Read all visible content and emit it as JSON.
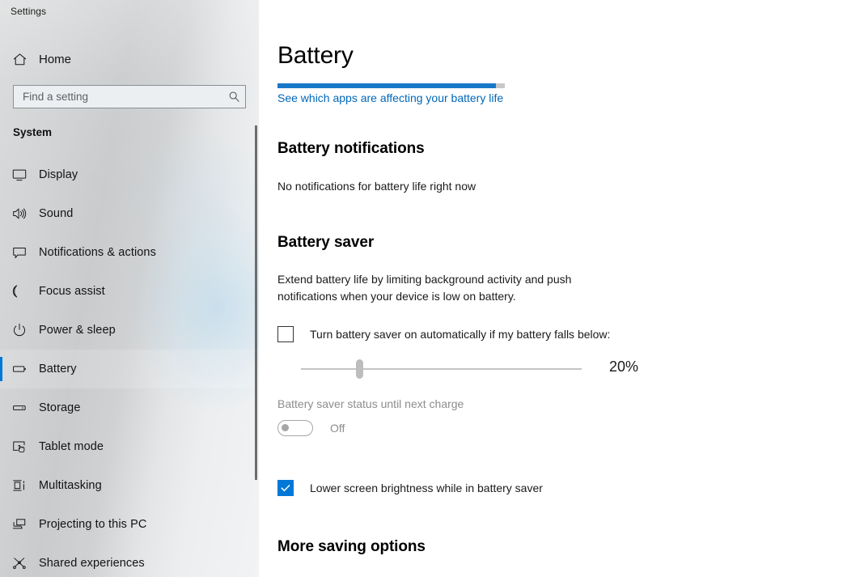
{
  "window": {
    "title": "Settings"
  },
  "sidebar": {
    "home": {
      "label": "Home",
      "icon": "home-icon"
    },
    "search": {
      "placeholder": "Find a setting",
      "value": "",
      "icon": "search-icon"
    },
    "group_title": "System",
    "items": [
      {
        "label": "Display",
        "icon": "monitor-icon",
        "selected": false
      },
      {
        "label": "Sound",
        "icon": "speaker-icon",
        "selected": false
      },
      {
        "label": "Notifications & actions",
        "icon": "comment-icon",
        "selected": false
      },
      {
        "label": "Focus assist",
        "icon": "moon-icon",
        "selected": false
      },
      {
        "label": "Power & sleep",
        "icon": "power-icon",
        "selected": false
      },
      {
        "label": "Battery",
        "icon": "battery-icon",
        "selected": true
      },
      {
        "label": "Storage",
        "icon": "drive-icon",
        "selected": false
      },
      {
        "label": "Tablet mode",
        "icon": "tablet-touch-icon",
        "selected": false
      },
      {
        "label": "Multitasking",
        "icon": "multitasking-icon",
        "selected": false
      },
      {
        "label": "Projecting to this PC",
        "icon": "project-screen-icon",
        "selected": false
      },
      {
        "label": "Shared experiences",
        "icon": "share-nodes-icon",
        "selected": false
      }
    ]
  },
  "main": {
    "page_title": "Battery",
    "battery_level_percent": 96,
    "battery_apps_link": "See which apps are affecting your battery life",
    "notifications": {
      "heading": "Battery notifications",
      "text": "No notifications for battery life right now"
    },
    "battery_saver": {
      "heading": "Battery saver",
      "description": "Extend battery life by limiting background activity and push notifications when your device is low on battery.",
      "auto_checkbox": {
        "label": "Turn battery saver on automatically if my battery falls below:",
        "checked": false
      },
      "threshold_slider": {
        "value": 20,
        "value_label": "20%",
        "min": 0,
        "max": 100,
        "disabled": true
      },
      "status_label": "Battery saver status until next charge",
      "status_toggle": {
        "state_label": "Off",
        "on": false,
        "disabled": true
      },
      "lower_brightness_checkbox": {
        "label": "Lower screen brightness while in battery saver",
        "checked": true
      }
    },
    "more_saving_options": {
      "heading": "More saving options"
    }
  },
  "colors": {
    "accent": "#0078d7",
    "link": "#0067b8",
    "battery_fill": "#1878c8",
    "battery_track": "#c8c8c8",
    "disabled_text": "#8d8d8d"
  }
}
